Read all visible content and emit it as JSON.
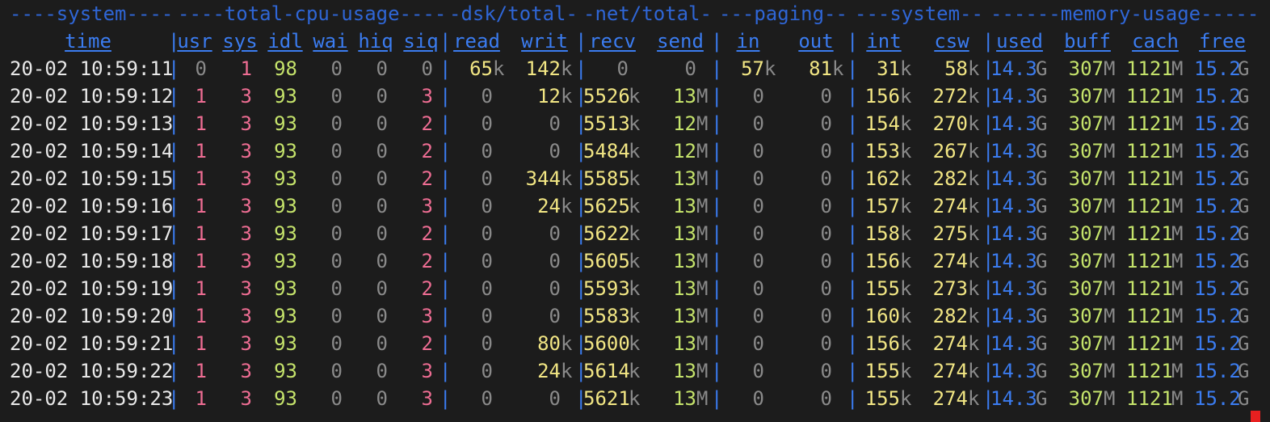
{
  "group_headers": [
    "----system----",
    "----total-cpu-usage----",
    "-dsk/total-",
    "-net/total-",
    "---paging--",
    "---system--",
    "------memory-usage-----"
  ],
  "column_headers": [
    "time",
    "usr",
    "sys",
    "idl",
    "wai",
    "hiq",
    "siq",
    "read",
    "writ",
    "recv",
    "send",
    "in",
    "out",
    "int",
    "csw",
    "used",
    "buff",
    "cach",
    "free"
  ],
  "separator": "|",
  "rows": [
    {
      "time": "20-02 10:59:11",
      "usr": "0",
      "sys": "1",
      "idl": "98",
      "wai": "0",
      "hiq": "0",
      "siq": "0",
      "read": "65",
      "read_u": "k",
      "writ": "142",
      "writ_u": "k",
      "recv": "0",
      "recv_u": "",
      "send": "0",
      "send_u": "",
      "in": "57",
      "in_u": "k",
      "out": "81",
      "out_u": "k",
      "int": "31",
      "int_u": "k",
      "csw": "58",
      "csw_u": "k",
      "used": "14.3",
      "used_u": "G",
      "buff": "307",
      "buff_u": "M",
      "cach": "1121",
      "cach_u": "M",
      "free": "15.2",
      "free_u": "G"
    },
    {
      "time": "20-02 10:59:12",
      "usr": "1",
      "sys": "3",
      "idl": "93",
      "wai": "0",
      "hiq": "0",
      "siq": "3",
      "read": "0",
      "read_u": "",
      "writ": "12",
      "writ_u": "k",
      "recv": "5526",
      "recv_u": "k",
      "send": "13",
      "send_u": "M",
      "in": "0",
      "in_u": "",
      "out": "0",
      "out_u": "",
      "int": "156",
      "int_u": "k",
      "csw": "272",
      "csw_u": "k",
      "used": "14.3",
      "used_u": "G",
      "buff": "307",
      "buff_u": "M",
      "cach": "1121",
      "cach_u": "M",
      "free": "15.2",
      "free_u": "G"
    },
    {
      "time": "20-02 10:59:13",
      "usr": "1",
      "sys": "3",
      "idl": "93",
      "wai": "0",
      "hiq": "0",
      "siq": "2",
      "read": "0",
      "read_u": "",
      "writ": "0",
      "writ_u": "",
      "recv": "5513",
      "recv_u": "k",
      "send": "12",
      "send_u": "M",
      "in": "0",
      "in_u": "",
      "out": "0",
      "out_u": "",
      "int": "154",
      "int_u": "k",
      "csw": "270",
      "csw_u": "k",
      "used": "14.3",
      "used_u": "G",
      "buff": "307",
      "buff_u": "M",
      "cach": "1121",
      "cach_u": "M",
      "free": "15.2",
      "free_u": "G"
    },
    {
      "time": "20-02 10:59:14",
      "usr": "1",
      "sys": "3",
      "idl": "93",
      "wai": "0",
      "hiq": "0",
      "siq": "2",
      "read": "0",
      "read_u": "",
      "writ": "0",
      "writ_u": "",
      "recv": "5484",
      "recv_u": "k",
      "send": "12",
      "send_u": "M",
      "in": "0",
      "in_u": "",
      "out": "0",
      "out_u": "",
      "int": "153",
      "int_u": "k",
      "csw": "267",
      "csw_u": "k",
      "used": "14.3",
      "used_u": "G",
      "buff": "307",
      "buff_u": "M",
      "cach": "1121",
      "cach_u": "M",
      "free": "15.2",
      "free_u": "G"
    },
    {
      "time": "20-02 10:59:15",
      "usr": "1",
      "sys": "3",
      "idl": "93",
      "wai": "0",
      "hiq": "0",
      "siq": "2",
      "read": "0",
      "read_u": "",
      "writ": "344",
      "writ_u": "k",
      "recv": "5585",
      "recv_u": "k",
      "send": "13",
      "send_u": "M",
      "in": "0",
      "in_u": "",
      "out": "0",
      "out_u": "",
      "int": "162",
      "int_u": "k",
      "csw": "282",
      "csw_u": "k",
      "used": "14.3",
      "used_u": "G",
      "buff": "307",
      "buff_u": "M",
      "cach": "1121",
      "cach_u": "M",
      "free": "15.2",
      "free_u": "G"
    },
    {
      "time": "20-02 10:59:16",
      "usr": "1",
      "sys": "3",
      "idl": "93",
      "wai": "0",
      "hiq": "0",
      "siq": "3",
      "read": "0",
      "read_u": "",
      "writ": "24",
      "writ_u": "k",
      "recv": "5625",
      "recv_u": "k",
      "send": "13",
      "send_u": "M",
      "in": "0",
      "in_u": "",
      "out": "0",
      "out_u": "",
      "int": "157",
      "int_u": "k",
      "csw": "274",
      "csw_u": "k",
      "used": "14.3",
      "used_u": "G",
      "buff": "307",
      "buff_u": "M",
      "cach": "1121",
      "cach_u": "M",
      "free": "15.2",
      "free_u": "G"
    },
    {
      "time": "20-02 10:59:17",
      "usr": "1",
      "sys": "3",
      "idl": "93",
      "wai": "0",
      "hiq": "0",
      "siq": "2",
      "read": "0",
      "read_u": "",
      "writ": "0",
      "writ_u": "",
      "recv": "5622",
      "recv_u": "k",
      "send": "13",
      "send_u": "M",
      "in": "0",
      "in_u": "",
      "out": "0",
      "out_u": "",
      "int": "158",
      "int_u": "k",
      "csw": "275",
      "csw_u": "k",
      "used": "14.3",
      "used_u": "G",
      "buff": "307",
      "buff_u": "M",
      "cach": "1121",
      "cach_u": "M",
      "free": "15.2",
      "free_u": "G"
    },
    {
      "time": "20-02 10:59:18",
      "usr": "1",
      "sys": "3",
      "idl": "93",
      "wai": "0",
      "hiq": "0",
      "siq": "2",
      "read": "0",
      "read_u": "",
      "writ": "0",
      "writ_u": "",
      "recv": "5605",
      "recv_u": "k",
      "send": "13",
      "send_u": "M",
      "in": "0",
      "in_u": "",
      "out": "0",
      "out_u": "",
      "int": "156",
      "int_u": "k",
      "csw": "274",
      "csw_u": "k",
      "used": "14.3",
      "used_u": "G",
      "buff": "307",
      "buff_u": "M",
      "cach": "1121",
      "cach_u": "M",
      "free": "15.2",
      "free_u": "G"
    },
    {
      "time": "20-02 10:59:19",
      "usr": "1",
      "sys": "3",
      "idl": "93",
      "wai": "0",
      "hiq": "0",
      "siq": "2",
      "read": "0",
      "read_u": "",
      "writ": "0",
      "writ_u": "",
      "recv": "5593",
      "recv_u": "k",
      "send": "13",
      "send_u": "M",
      "in": "0",
      "in_u": "",
      "out": "0",
      "out_u": "",
      "int": "155",
      "int_u": "k",
      "csw": "273",
      "csw_u": "k",
      "used": "14.3",
      "used_u": "G",
      "buff": "307",
      "buff_u": "M",
      "cach": "1121",
      "cach_u": "M",
      "free": "15.2",
      "free_u": "G"
    },
    {
      "time": "20-02 10:59:20",
      "usr": "1",
      "sys": "3",
      "idl": "93",
      "wai": "0",
      "hiq": "0",
      "siq": "3",
      "read": "0",
      "read_u": "",
      "writ": "0",
      "writ_u": "",
      "recv": "5583",
      "recv_u": "k",
      "send": "13",
      "send_u": "M",
      "in": "0",
      "in_u": "",
      "out": "0",
      "out_u": "",
      "int": "160",
      "int_u": "k",
      "csw": "282",
      "csw_u": "k",
      "used": "14.3",
      "used_u": "G",
      "buff": "307",
      "buff_u": "M",
      "cach": "1121",
      "cach_u": "M",
      "free": "15.2",
      "free_u": "G"
    },
    {
      "time": "20-02 10:59:21",
      "usr": "1",
      "sys": "3",
      "idl": "93",
      "wai": "0",
      "hiq": "0",
      "siq": "2",
      "read": "0",
      "read_u": "",
      "writ": "80",
      "writ_u": "k",
      "recv": "5600",
      "recv_u": "k",
      "send": "13",
      "send_u": "M",
      "in": "0",
      "in_u": "",
      "out": "0",
      "out_u": "",
      "int": "156",
      "int_u": "k",
      "csw": "274",
      "csw_u": "k",
      "used": "14.3",
      "used_u": "G",
      "buff": "307",
      "buff_u": "M",
      "cach": "1121",
      "cach_u": "M",
      "free": "15.2",
      "free_u": "G"
    },
    {
      "time": "20-02 10:59:22",
      "usr": "1",
      "sys": "3",
      "idl": "93",
      "wai": "0",
      "hiq": "0",
      "siq": "3",
      "read": "0",
      "read_u": "",
      "writ": "24",
      "writ_u": "k",
      "recv": "5614",
      "recv_u": "k",
      "send": "13",
      "send_u": "M",
      "in": "0",
      "in_u": "",
      "out": "0",
      "out_u": "",
      "int": "155",
      "int_u": "k",
      "csw": "274",
      "csw_u": "k",
      "used": "14.3",
      "used_u": "G",
      "buff": "307",
      "buff_u": "M",
      "cach": "1121",
      "cach_u": "M",
      "free": "15.2",
      "free_u": "G"
    },
    {
      "time": "20-02 10:59:23",
      "usr": "1",
      "sys": "3",
      "idl": "93",
      "wai": "0",
      "hiq": "0",
      "siq": "3",
      "read": "0",
      "read_u": "",
      "writ": "0",
      "writ_u": "",
      "recv": "5621",
      "recv_u": "k",
      "send": "13",
      "send_u": "M",
      "in": "0",
      "in_u": "",
      "out": "0",
      "out_u": "",
      "int": "155",
      "int_u": "k",
      "csw": "274",
      "csw_u": "k",
      "used": "14.3",
      "used_u": "G",
      "buff": "307",
      "buff_u": "M",
      "cach": "1121",
      "cach_u": "M",
      "free": "15.2",
      "free_u": "G"
    }
  ],
  "cursor_color": "#e82020"
}
